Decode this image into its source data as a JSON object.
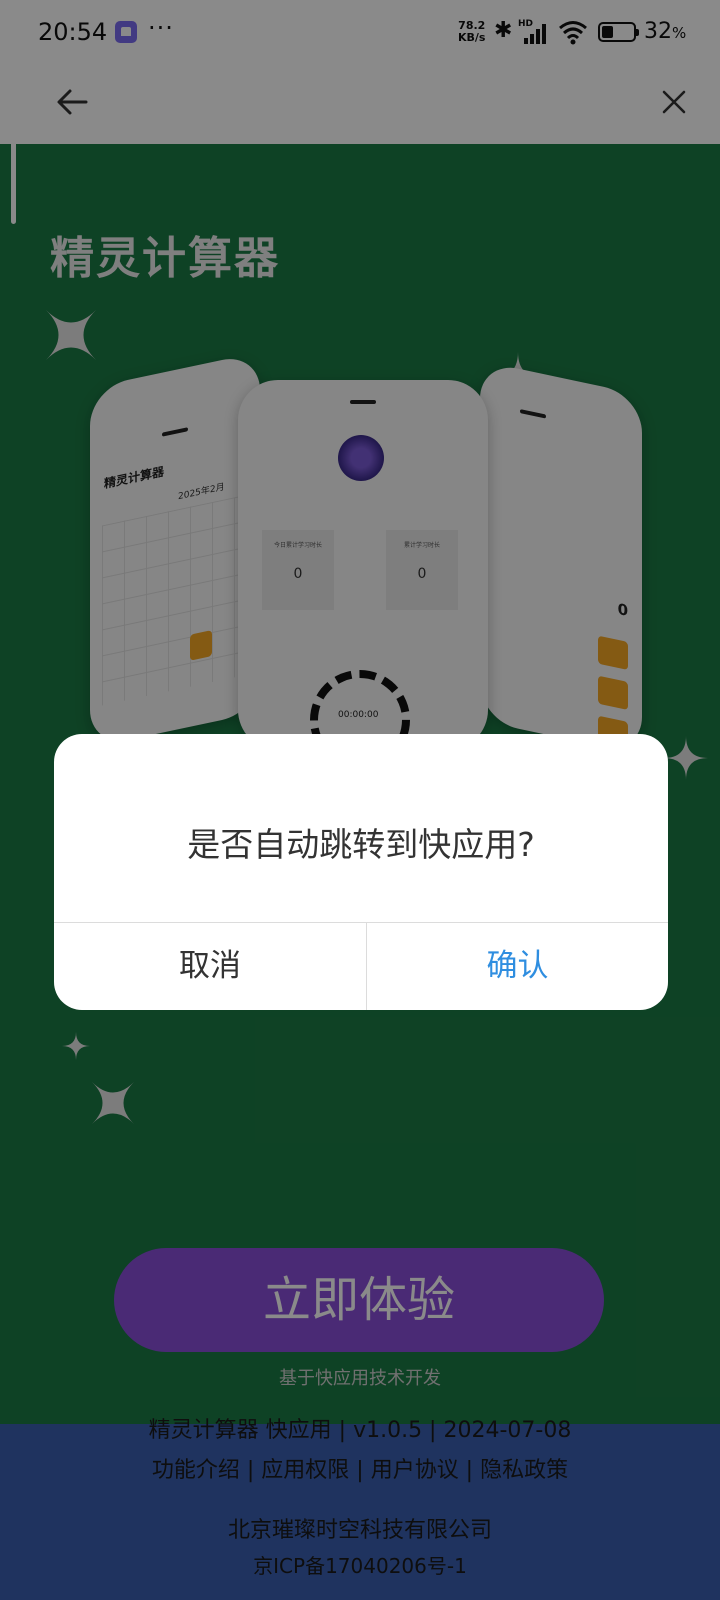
{
  "status_bar": {
    "time": "20:54",
    "more": "···",
    "net_speed_value": "78.2",
    "net_speed_unit": "KB/s",
    "hd_label": "HD",
    "battery_percent": "32",
    "battery_unit": "%",
    "app_icon": "notification-app-icon",
    "icons": [
      "bluetooth-icon",
      "signal-icon",
      "wifi-icon",
      "battery-icon"
    ]
  },
  "nav": {
    "back_icon": "back-arrow-icon",
    "close_icon": "close-icon"
  },
  "page": {
    "app_title": "精灵计算器",
    "preview": {
      "left_title": "精灵计算器",
      "left_month": "2025年2月",
      "mid_box1_label": "今日累计学习时长",
      "mid_box1_value": "0",
      "mid_box2_label": "累计学习时长",
      "mid_box2_value": "0",
      "mid_timer": "00:00:00",
      "right_display": "0"
    },
    "cta_label": "立即体验",
    "cta_sub": "基于快应用技术开发",
    "footer": {
      "line1": "精灵计算器 快应用 | v1.0.5 | 2024-07-08",
      "line2": "功能介绍 | 应用权限 | 用户协议 | 隐私政策",
      "company": "北京璀璨时空科技有限公司",
      "icp": "京ICP备17040206号-1"
    }
  },
  "dialog": {
    "message": "是否自动跳转到快应用?",
    "cancel_label": "取消",
    "confirm_label": "确认"
  },
  "colors": {
    "page_green": "#1b7a45",
    "cta_purple": "#8a4fd8",
    "footer_blue": "#3a5fb0",
    "confirm_blue": "#2f8ee0",
    "overlay": "rgba(0,0,0,0.46)"
  }
}
